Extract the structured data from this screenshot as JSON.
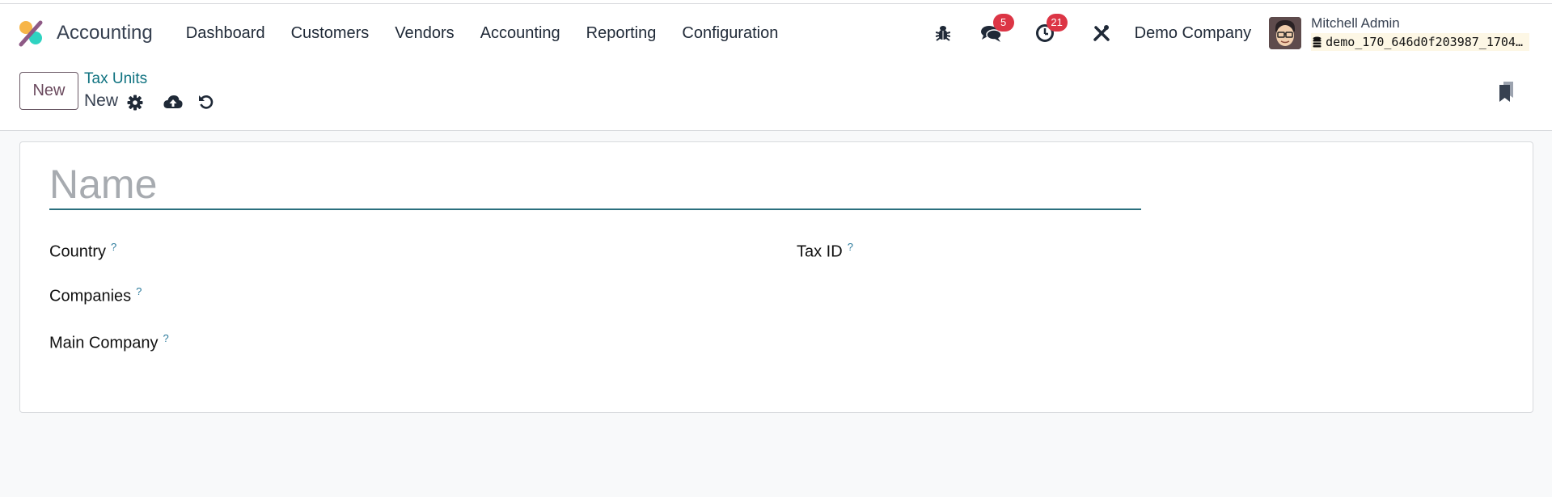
{
  "navbar": {
    "app_name": "Accounting",
    "menu": [
      {
        "label": "Dashboard"
      },
      {
        "label": "Customers"
      },
      {
        "label": "Vendors"
      },
      {
        "label": "Accounting"
      },
      {
        "label": "Reporting"
      },
      {
        "label": "Configuration"
      }
    ],
    "messages_count": "5",
    "activities_count": "21",
    "company": "Demo Company",
    "user_name": "Mitchell Admin",
    "database": "demo_170_646d0f203987_1704…"
  },
  "controlbar": {
    "new_label": "New",
    "breadcrumb": "Tax Units",
    "record_name": "New"
  },
  "form": {
    "name_placeholder": "Name",
    "name_value": "",
    "fields": {
      "country": "Country",
      "tax_id": "Tax ID",
      "companies": "Companies",
      "main_company": "Main Company"
    },
    "help_mark": "?"
  },
  "colors": {
    "accent": "#0f7280",
    "brand_purple": "#714b67",
    "badge": "#dc3545"
  }
}
